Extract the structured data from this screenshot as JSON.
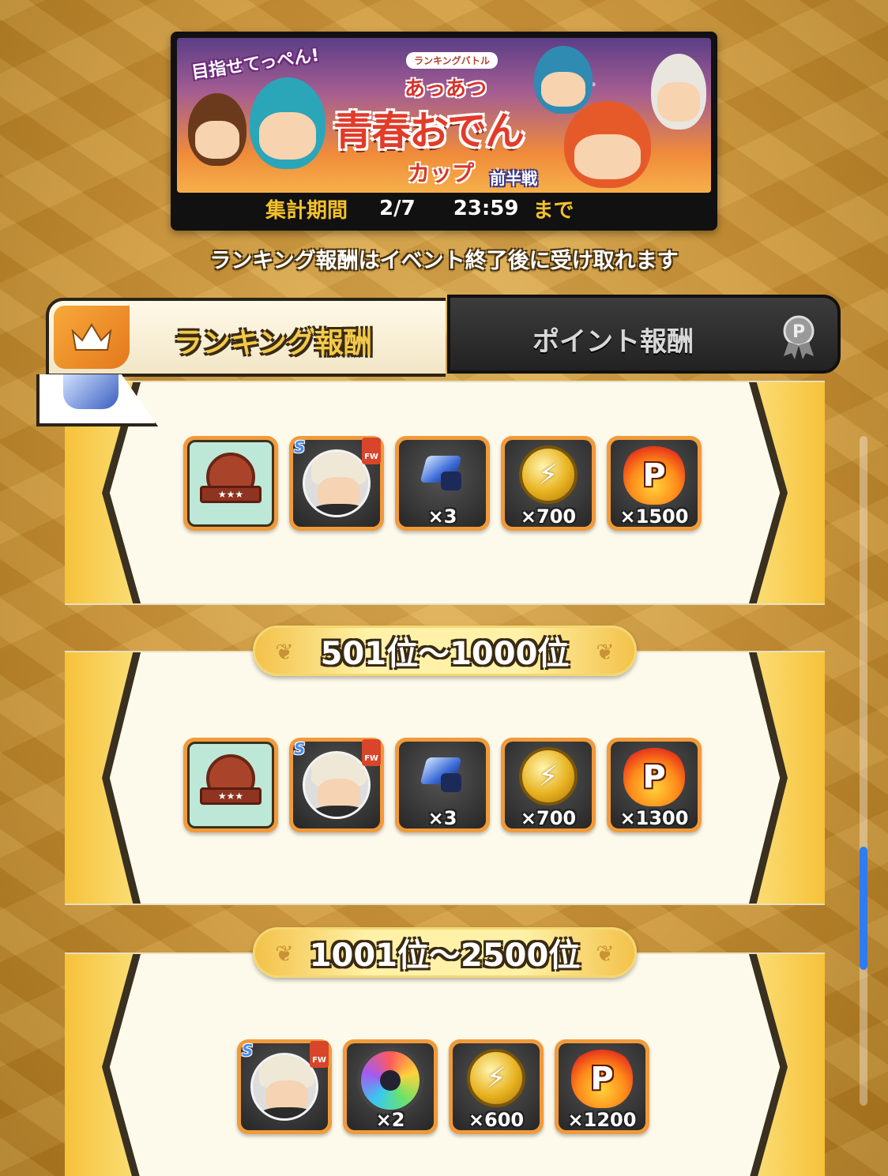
{
  "banner": {
    "slogan": "目指せてっぺん!",
    "battle_label": "ランキングバトル",
    "subtitle": "あっあつ",
    "title": "青春おでん",
    "cup": "カップ",
    "half": "前半戦",
    "period_label": "集計期間",
    "period_date": "2/7",
    "period_time": "23:59",
    "period_until": "まで"
  },
  "notice": "ランキング報酬はイベント終了後に受け取れます",
  "tabs": {
    "ranking": "ランキング報酬",
    "point": "ポイント報酬"
  },
  "ranks": [
    {
      "label": "",
      "rewards": [
        {
          "type": "emblem",
          "icon": "emblem-icon",
          "qty": ""
        },
        {
          "type": "player",
          "icon": "player-card-icon",
          "rarity": "S",
          "position": "FW",
          "qty": ""
        },
        {
          "type": "gem",
          "icon": "gem-icon",
          "qty": "×3"
        },
        {
          "type": "coin",
          "icon": "lightning-coin-icon",
          "qty": "×700"
        },
        {
          "type": "point",
          "icon": "p-flame-icon",
          "qty": "×1500"
        }
      ]
    },
    {
      "label": "501位〜1000位",
      "rewards": [
        {
          "type": "emblem",
          "icon": "emblem-icon",
          "qty": ""
        },
        {
          "type": "player",
          "icon": "player-card-icon",
          "rarity": "S",
          "position": "FW",
          "qty": ""
        },
        {
          "type": "gem",
          "icon": "gem-icon",
          "qty": "×3"
        },
        {
          "type": "coin",
          "icon": "lightning-coin-icon",
          "qty": "×700"
        },
        {
          "type": "point",
          "icon": "p-flame-icon",
          "qty": "×1300"
        }
      ]
    },
    {
      "label": "1001位〜2500位",
      "rewards": [
        {
          "type": "player",
          "icon": "player-card-icon",
          "rarity": "S",
          "position": "FW",
          "qty": ""
        },
        {
          "type": "wheel",
          "icon": "rainbow-wheel-icon",
          "qty": "×2"
        },
        {
          "type": "coin",
          "icon": "lightning-coin-icon",
          "qty": "×600"
        },
        {
          "type": "point",
          "icon": "p-flame-icon",
          "qty": "×1200"
        }
      ]
    }
  ],
  "colors": {
    "accent": "#f19a3a",
    "scroll_thumb": "#2f7cf0"
  }
}
